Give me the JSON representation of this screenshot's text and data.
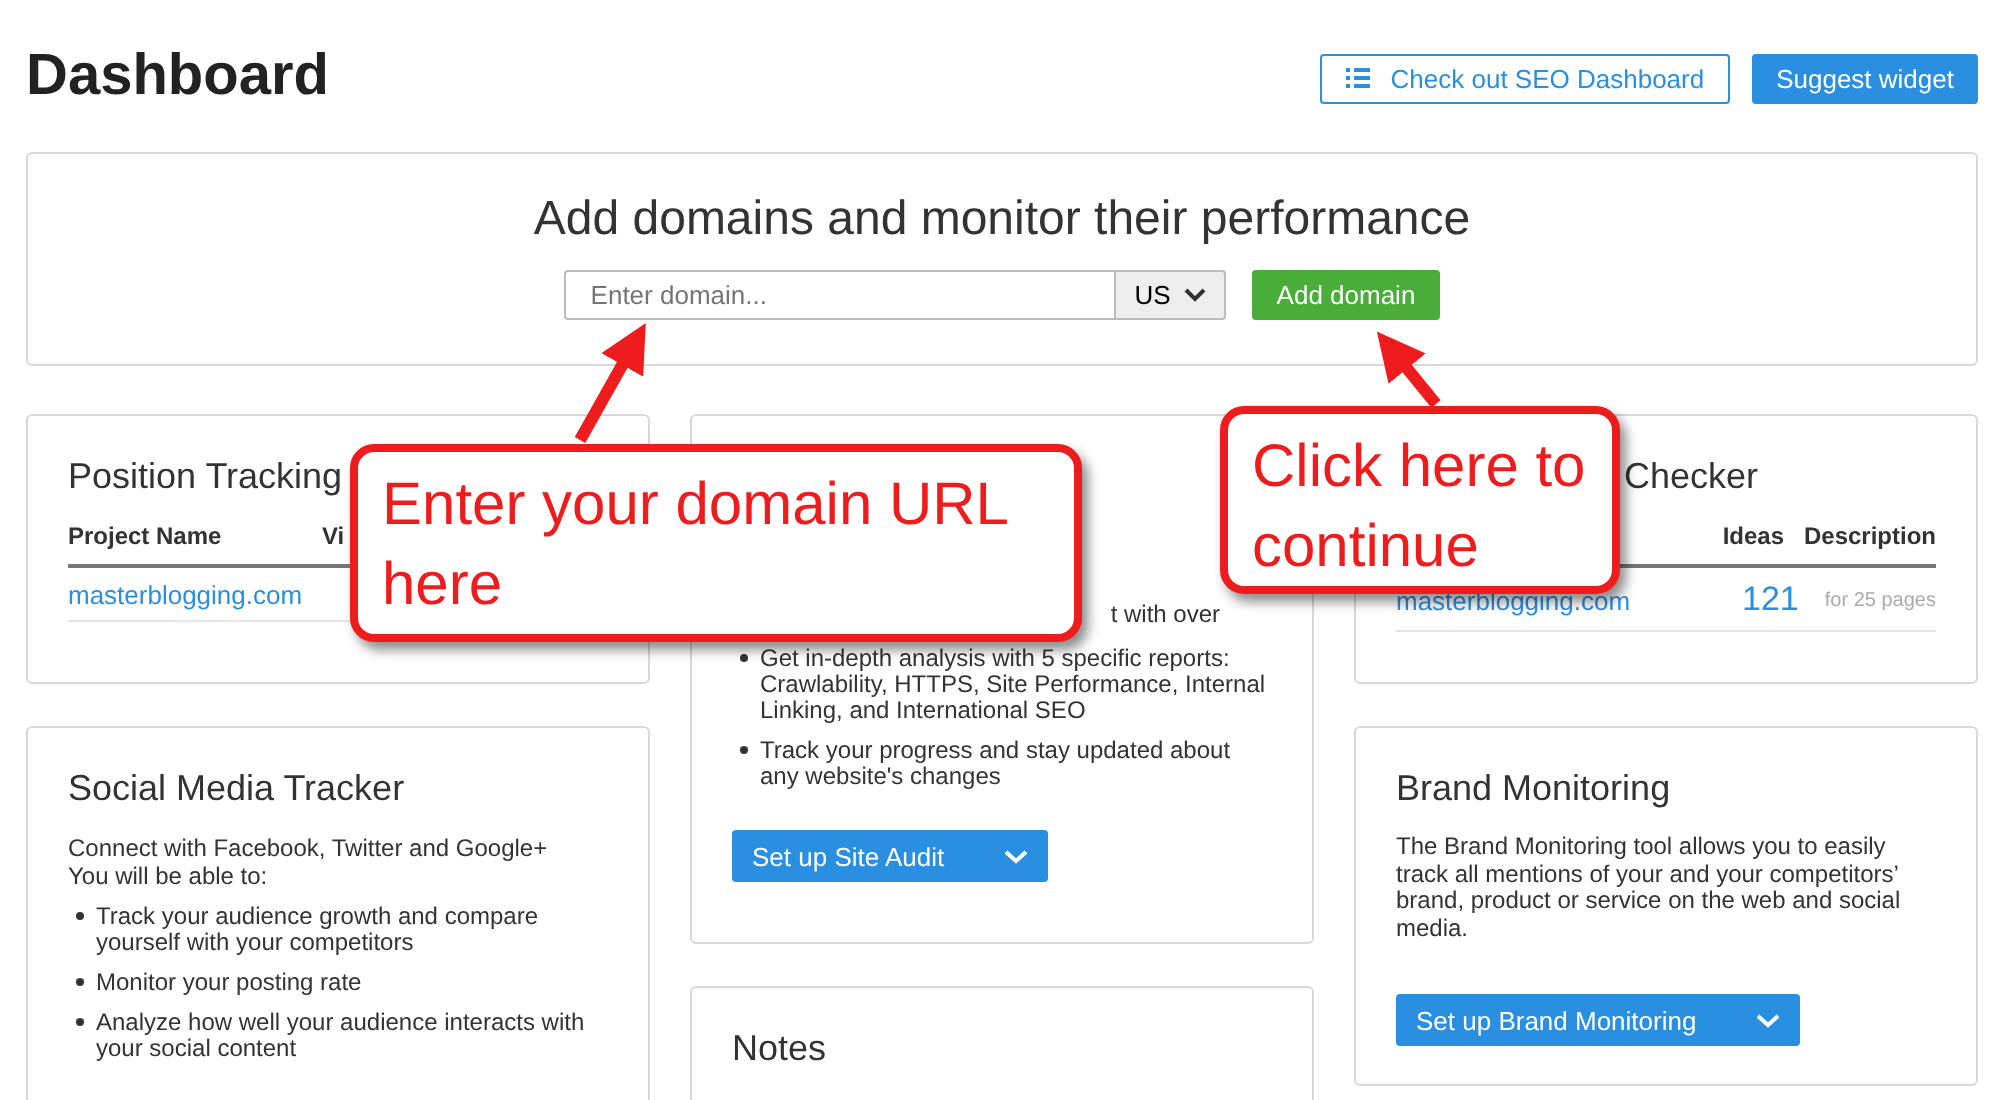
{
  "page_title": "Dashboard",
  "header_buttons": [
    {
      "label": "Check out SEO Dashboard",
      "kind": "outline"
    },
    {
      "label": "Suggest widget",
      "kind": "primary"
    }
  ],
  "add_domain": {
    "title": "Add domains and monitor their performance",
    "placeholder": "Enter domain...",
    "country": "US",
    "button": "Add domain"
  },
  "position_tracking": {
    "title": "Position Tracking",
    "columns": [
      "Project Name",
      "Vi"
    ],
    "rows": [
      "masterblogging.com"
    ]
  },
  "social_media": {
    "title": "Social Media Tracker",
    "intro": [
      "Connect with Facebook, Twitter and Google+",
      "You will be able to:"
    ],
    "bullets": [
      "Track your audience growth and compare yourself with your competitors",
      "Monitor your posting rate",
      "Analyze how well your audience interacts with your social content"
    ]
  },
  "site_audit": {
    "intro_fragment": "t with over",
    "bullets": [
      "Get in-depth analysis with 5 specific reports: Crawlability, HTTPS, Site Performance, Internal Linking, and International SEO",
      "Track your progress and stay updated about any website's changes"
    ],
    "button": "Set up Site Audit"
  },
  "notes": {
    "title": "Notes"
  },
  "checker": {
    "title": "Checker",
    "columns": [
      "Ideas",
      "Description"
    ],
    "rows": [
      {
        "domain": "masterblogging.com",
        "ideas": "121",
        "description": "for 25 pages"
      }
    ]
  },
  "brand_monitoring": {
    "title": "Brand Monitoring",
    "text": "The Brand Monitoring tool allows you to easily track all mentions of your and your competitors’ brand, product or service on the web and social media.",
    "button": "Set up Brand Monitoring"
  },
  "callouts": [
    {
      "text": "Enter your domain URL here"
    },
    {
      "text": "Click here to continue"
    }
  ]
}
